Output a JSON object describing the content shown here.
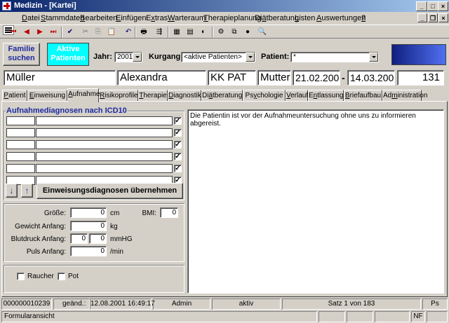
{
  "window": {
    "title": "Medizin - [Kartei]"
  },
  "menu": [
    {
      "pre": "",
      "u": "D",
      "post": "atei"
    },
    {
      "pre": "",
      "u": "S",
      "post": "tammdaten"
    },
    {
      "pre": "",
      "u": "B",
      "post": "earbeiten"
    },
    {
      "pre": "",
      "u": "E",
      "post": "infügen"
    },
    {
      "pre": "E",
      "u": "x",
      "post": "tras"
    },
    {
      "pre": "",
      "u": "W",
      "post": "arteraum"
    },
    {
      "pre": "",
      "u": "T",
      "post": "herapieplanung"
    },
    {
      "pre": "Di",
      "u": "ä",
      "post": "tberatung"
    },
    {
      "pre": "",
      "u": "L",
      "post": "isten"
    },
    {
      "pre": "",
      "u": "A",
      "post": "uswertungen"
    },
    {
      "pre": "",
      "u": "?",
      "post": ""
    }
  ],
  "toolbar": {
    "icons": [
      "first-record-icon",
      "prev-record-icon",
      "next-record-icon",
      "last-record-icon",
      "save-icon",
      "cut-icon",
      "copy-icon",
      "paste-icon",
      "delete-icon",
      "undo-icon",
      "print-icon",
      "sort-icon",
      "patient-card-icon",
      "document-icon",
      "settings-icon",
      "tools-icon",
      "filter-icon",
      "help-icon",
      "binoculars-icon"
    ],
    "glyphs": [
      "⏮",
      "◀",
      "▶",
      "⏭",
      "✔",
      "✂",
      "⎘",
      "📋",
      "✖",
      "↶",
      "🖶",
      "⇶",
      "▦",
      "▤",
      "◐",
      "⚙",
      "⧉",
      "●",
      "🔍"
    ]
  },
  "top": {
    "familie_label": "Familie suchen",
    "aktive_label": "Aktive Patienten",
    "jahr_label": "Jahr:",
    "jahr_value": "2001",
    "kurgang_label": "Kurgang:",
    "kurgang_value": "<aktive Patienten>",
    "patient_label": "Patient:",
    "patient_value": "*"
  },
  "header": {
    "lastname": "Müller",
    "firstname": "Alexandra",
    "kk": "KK PAT",
    "role": "Mutter",
    "date_from": "21.02.2001",
    "dash": "-",
    "date_to": "14.03.2001",
    "number": "131"
  },
  "tabs": [
    {
      "pre": "",
      "u": "P",
      "post": "atient",
      "active": false
    },
    {
      "pre": "",
      "u": "E",
      "post": "inweisung",
      "active": false
    },
    {
      "pre": "",
      "u": "A",
      "post": "ufnahme",
      "active": true
    },
    {
      "pre": "",
      "u": "R",
      "post": "isikoprofile",
      "active": false
    },
    {
      "pre": "",
      "u": "T",
      "post": "herapie",
      "active": false
    },
    {
      "pre": "",
      "u": "D",
      "post": "iagnostik",
      "active": false
    },
    {
      "pre": "Di",
      "u": "ä",
      "post": "tberatung",
      "active": false
    },
    {
      "pre": "Ps",
      "u": "y",
      "post": "chologie",
      "active": false
    },
    {
      "pre": "",
      "u": "V",
      "post": "erlauf",
      "active": false
    },
    {
      "pre": "E",
      "u": "n",
      "post": "tlassung",
      "active": false
    },
    {
      "pre": "",
      "u": "B",
      "post": "riefaufbau",
      "active": false
    },
    {
      "pre": "Ad",
      "u": "m",
      "post": "inistration",
      "active": false
    }
  ],
  "aufnahme": {
    "group_title": "Aufnahmediagnosen nach ICD10",
    "diagnosis_rows": [
      {
        "code": "",
        "text": "",
        "checked": true
      },
      {
        "code": "",
        "text": "",
        "checked": true
      },
      {
        "code": "",
        "text": "",
        "checked": true
      },
      {
        "code": "",
        "text": "",
        "checked": true
      },
      {
        "code": "",
        "text": "",
        "checked": true
      },
      {
        "code": "",
        "text": "",
        "checked": true
      }
    ],
    "check_mark": "✓",
    "down_arrow": "↓",
    "up_arrow": "↑",
    "transfer_button": "Einweisungsdiagnosen übernehmen",
    "groesse_label": "Größe:",
    "groesse_value": "0",
    "groesse_unit": "cm",
    "bmi_label": "BMI:",
    "bmi_value": "0",
    "gewicht_label": "Gewicht Anfang:",
    "gewicht_value": "0",
    "gewicht_unit": "kg",
    "blutdruck_label": "Blutdruck Anfang:",
    "blutdruck_sys": "0",
    "blutdruck_dia": "0",
    "blutdruck_unit": "mmHG",
    "puls_label": "Puls Anfang:",
    "puls_value": "0",
    "puls_unit": "/min",
    "raucher_label": "Raucher",
    "pot_label": "Pot",
    "memo_text": "Die Patientin ist vor der Aufnahmeuntersuchung ohne uns zu informieren abgereist."
  },
  "status": {
    "id": "000000010239",
    "changed_label": "geänd.:",
    "changed_value": "12.08.2001 16:49:17",
    "user": "Admin",
    "state": "aktiv",
    "record": "Satz 1 von 183",
    "ps": "Ps"
  },
  "footer": {
    "view": "Formularansicht",
    "nf": "NF"
  },
  "colors": {
    "title_start": "#0a246a",
    "accent_blue": "#1f2ba0",
    "cyan": "#00ffff"
  }
}
